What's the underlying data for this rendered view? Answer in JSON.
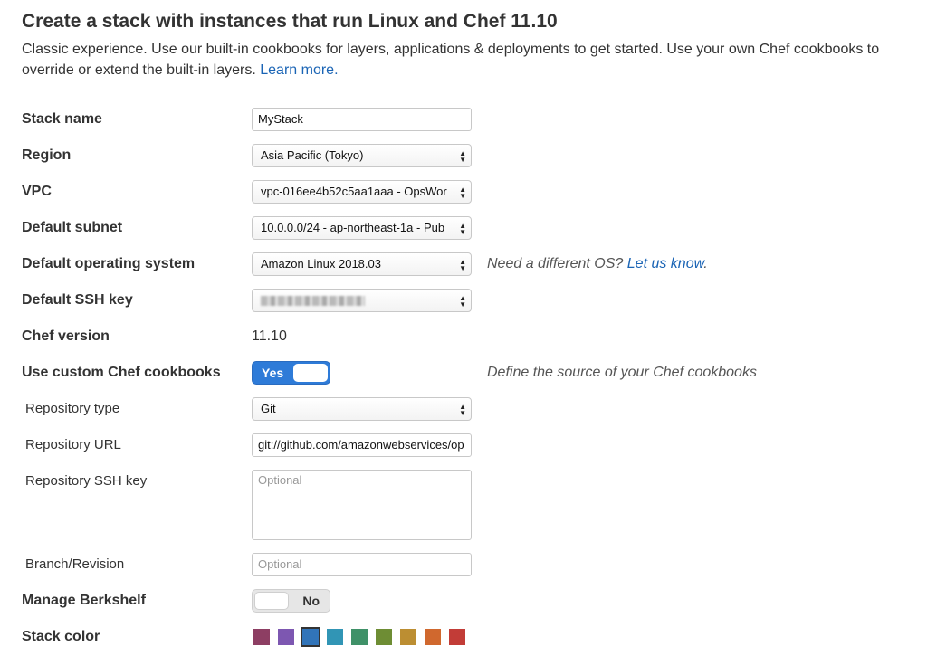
{
  "header": {
    "title": "Create a stack with instances that run Linux and Chef 11.10",
    "description": "Classic experience. Use our built-in cookbooks for layers, applications & deployments to get started. Use your own Chef cookbooks to override or extend the built-in layers.",
    "learn_more_label": "Learn more."
  },
  "form": {
    "stack_name": {
      "label": "Stack name",
      "value": "MyStack"
    },
    "region": {
      "label": "Region",
      "value": "Asia Pacific (Tokyo)"
    },
    "vpc": {
      "label": "VPC",
      "value": "vpc-016ee4b52c5aa1aaa - OpsWor"
    },
    "default_subnet": {
      "label": "Default subnet",
      "value": "10.0.0.0/24 - ap-northeast-1a - Pub"
    },
    "default_os": {
      "label": "Default operating system",
      "value": "Amazon Linux 2018.03",
      "hint_prefix": "Need a different OS?",
      "hint_link": "Let us know",
      "hint_suffix": "."
    },
    "default_ssh_key": {
      "label": "Default SSH key"
    },
    "chef_version": {
      "label": "Chef version",
      "value": "11.10"
    },
    "custom_cookbooks": {
      "label": "Use custom Chef cookbooks",
      "toggle_label": "Yes",
      "hint": "Define the source of your Chef cookbooks"
    },
    "repository_type": {
      "label": "Repository type",
      "value": "Git"
    },
    "repository_url": {
      "label": "Repository URL",
      "value": "git://github.com/amazonwebservices/op"
    },
    "repository_ssh_key": {
      "label": "Repository SSH key",
      "placeholder": "Optional"
    },
    "branch_revision": {
      "label": "Branch/Revision",
      "placeholder": "Optional"
    },
    "manage_berkshelf": {
      "label": "Manage Berkshelf",
      "toggle_label": "No"
    },
    "stack_color": {
      "label": "Stack color",
      "colors": [
        "#8d3e63",
        "#7d57b1",
        "#3174b9",
        "#3195b5",
        "#3f9168",
        "#6e8d34",
        "#bc8e32",
        "#d0682e",
        "#c23c37"
      ],
      "selected_index": 2
    }
  },
  "icons": {
    "select_arrow": "updown-arrows-icon"
  }
}
